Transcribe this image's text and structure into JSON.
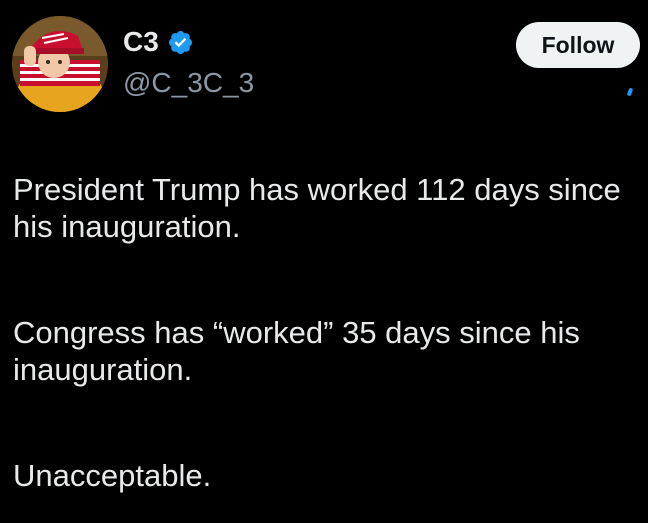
{
  "author": {
    "display_name": "C3",
    "handle": "@C_3C_3",
    "verified": true,
    "avatar_icon": "avatar-photo",
    "verified_icon": "verified-badge-icon"
  },
  "follow_button": {
    "label": "Follow"
  },
  "tweet": {
    "paragraphs": [
      "President Trump has worked 112 days since his inauguration.",
      "Congress has “worked” 35 days since his inauguration.",
      "Unacceptable."
    ]
  },
  "colors": {
    "background": "#000000",
    "text": "#e7e9ea",
    "secondary_text": "#8b98a5",
    "verified": "#1d9bf0",
    "follow_bg": "#eff3f4"
  }
}
